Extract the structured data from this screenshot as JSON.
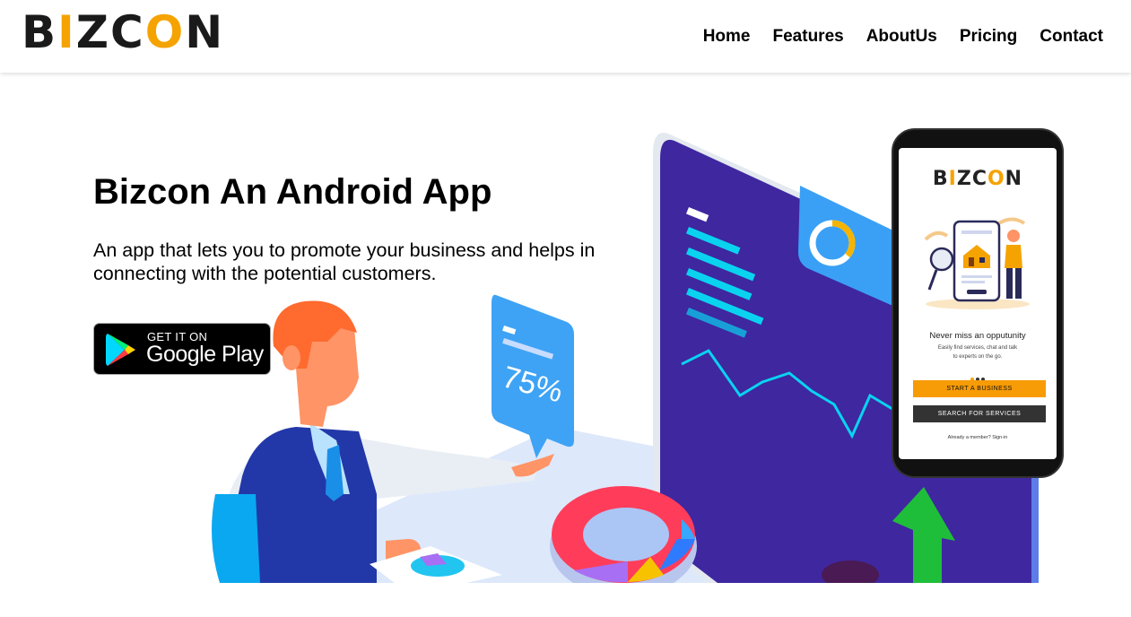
{
  "header": {
    "logo": {
      "b": "B",
      "i": "I",
      "z": "Z",
      "c": "C",
      "o": "O",
      "n": "N"
    },
    "nav": [
      "Home",
      "Features",
      "AboutUs",
      "Pricing",
      "Contact"
    ]
  },
  "hero": {
    "title": "Bizcon An Android App",
    "description": "An app that lets you to promote your business and helps in connecting with the potential customers.",
    "store_badge": {
      "small": "GET IT ON",
      "big": "Google Play"
    },
    "bubble_percent": "75%"
  },
  "phone": {
    "logo": {
      "b": "B",
      "i": "I",
      "z": "Z",
      "c": "C",
      "o": "O",
      "n": "N"
    },
    "heading": "Never miss an opputunity",
    "sub_line1": "Easily find services, chat and talk",
    "sub_line2": "to experts on the go.",
    "start_button": "START A BUSINESS",
    "search_button": "SEARCH FOR SERVICES",
    "signin": "Already a member? Sign-in"
  },
  "colors": {
    "accent": "#f5a300",
    "panel": "#3f27a0",
    "chart_blue": "#0ad3f0"
  }
}
